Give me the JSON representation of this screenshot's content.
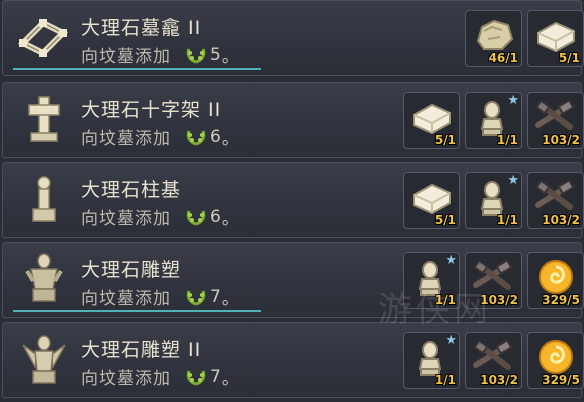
{
  "rows": [
    {
      "name": "大理石墓龕 II",
      "action": "向坟墓添加",
      "score": "5",
      "period": "。",
      "thumb": "frame",
      "underline": true,
      "costs": [
        {
          "icon": "marble-rock-icon",
          "qty": "46/1"
        },
        {
          "icon": "marble-slab-icon",
          "qty": "5/1"
        }
      ]
    },
    {
      "name": "大理石十字架 II",
      "action": "向坟墓添加",
      "score": "6",
      "period": "。",
      "thumb": "cross",
      "underline": false,
      "costs": [
        {
          "icon": "marble-slab-icon",
          "qty": "5/1"
        },
        {
          "icon": "bust-icon",
          "qty": "1/1"
        },
        {
          "icon": "tools-icon",
          "qty": "103/2"
        }
      ]
    },
    {
      "name": "大理石柱基",
      "action": "向坟墓添加",
      "score": "6",
      "period": "。",
      "thumb": "pillar",
      "underline": false,
      "costs": [
        {
          "icon": "marble-slab-icon",
          "qty": "5/1"
        },
        {
          "icon": "bust-icon",
          "qty": "1/1"
        },
        {
          "icon": "tools-icon",
          "qty": "103/2"
        }
      ]
    },
    {
      "name": "大理石雕塑",
      "action": "向坟墓添加",
      "score": "7",
      "period": "。",
      "thumb": "statue",
      "underline": true,
      "costs": [
        {
          "icon": "bust-icon",
          "qty": "1/1"
        },
        {
          "icon": "tools-icon",
          "qty": "103/2"
        },
        {
          "icon": "gold-orb-icon",
          "qty": "329/5"
        }
      ]
    },
    {
      "name": "大理石雕塑 II",
      "action": "向坟墓添加",
      "score": "7",
      "period": "。",
      "thumb": "angel",
      "underline": false,
      "costs": [
        {
          "icon": "bust-icon",
          "qty": "1/1"
        },
        {
          "icon": "tools-icon",
          "qty": "103/2"
        },
        {
          "icon": "gold-orb-icon",
          "qty": "329/5"
        }
      ]
    }
  ],
  "watermark": "游侠网"
}
